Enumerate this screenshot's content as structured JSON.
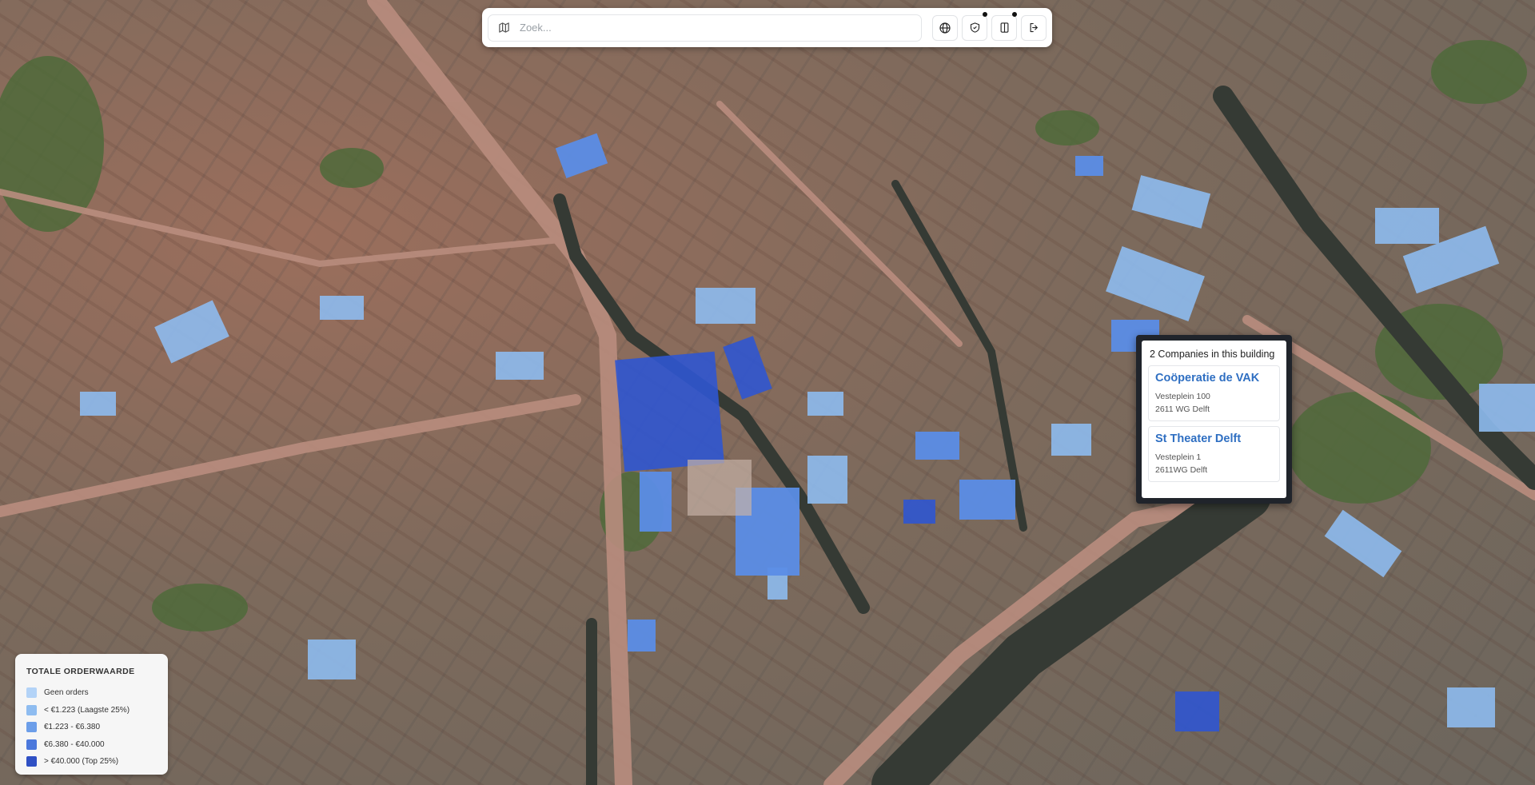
{
  "search": {
    "placeholder": "Zoek..."
  },
  "toolbar": {
    "buttons": [
      {
        "icon": "globe-icon"
      },
      {
        "icon": "shield-icon",
        "badge": true
      },
      {
        "icon": "panel-icon",
        "badge": true
      },
      {
        "icon": "logout-icon"
      }
    ]
  },
  "popup": {
    "title": "2 Companies in this building",
    "companies": [
      {
        "name": "Coöperatie de VAK",
        "address": "Vesteplein 100",
        "postal": "2611 WG Delft"
      },
      {
        "name": "St Theater Delft",
        "address": "Vesteplein 1",
        "postal": "2611WG Delft"
      }
    ]
  },
  "legend": {
    "title": "TOTALE ORDERWAARDE",
    "items": [
      {
        "label": "Geen orders",
        "color": "#b3d3f7"
      },
      {
        "label": "< €1.223 (Laagste 25%)",
        "color": "#8ebcf0"
      },
      {
        "label": "€1.223 - €6.380",
        "color": "#6c9ee9"
      },
      {
        "label": "€6.380 - €40.000",
        "color": "#4b78dc"
      },
      {
        "label": "> €40.000 (Top 25%)",
        "color": "#2f50c4"
      }
    ]
  },
  "colors": {
    "building_light": "#7fb0f0",
    "building_mid": "#5b8ee6",
    "building_dark": "#2f56d2",
    "canal": "#3a3f38",
    "road": "#b88a7c"
  }
}
